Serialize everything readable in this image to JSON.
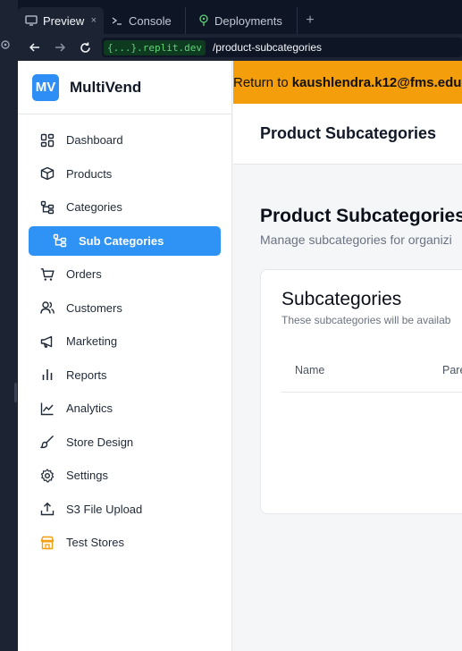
{
  "browser": {
    "tabs": [
      {
        "label": "Preview",
        "close": "×"
      },
      {
        "label": "Console"
      },
      {
        "label": "Deployments"
      }
    ],
    "new_tab": "+",
    "url_host": "{...}.replit.dev",
    "url_path": "/product-subcategories"
  },
  "app": {
    "logo": "MV",
    "name": "MultiVend"
  },
  "sidebar": {
    "items": [
      {
        "label": "Dashboard",
        "icon": "grid-icon"
      },
      {
        "label": "Products",
        "icon": "box-icon"
      },
      {
        "label": "Categories",
        "icon": "category-tree-icon"
      },
      {
        "label": "Sub Categories",
        "icon": "subcategory-tree-icon",
        "active": true
      },
      {
        "label": "Orders",
        "icon": "cart-icon"
      },
      {
        "label": "Customers",
        "icon": "users-icon"
      },
      {
        "label": "Marketing",
        "icon": "megaphone-icon"
      },
      {
        "label": "Reports",
        "icon": "bar-chart-icon"
      },
      {
        "label": "Analytics",
        "icon": "line-chart-icon"
      },
      {
        "label": "Store Design",
        "icon": "brush-icon"
      },
      {
        "label": "Settings",
        "icon": "gear-icon"
      },
      {
        "label": "S3 File Upload",
        "icon": "upload-icon"
      },
      {
        "label": "Test Stores",
        "icon": "store-icon"
      }
    ]
  },
  "banner": {
    "prefix": "Return to",
    "email": "kaushlendra.k12@fms.edu"
  },
  "header": {
    "title": "Product Subcategories"
  },
  "page": {
    "heading": "Product Subcategories",
    "subtitle": "Manage subcategories for organizi"
  },
  "card": {
    "title": "Subcategories",
    "description": "These subcategories will be availab",
    "columns": [
      "Name",
      "Pare"
    ]
  },
  "colors": {
    "accent": "#2f93f6",
    "banner": "#f59e0b"
  }
}
